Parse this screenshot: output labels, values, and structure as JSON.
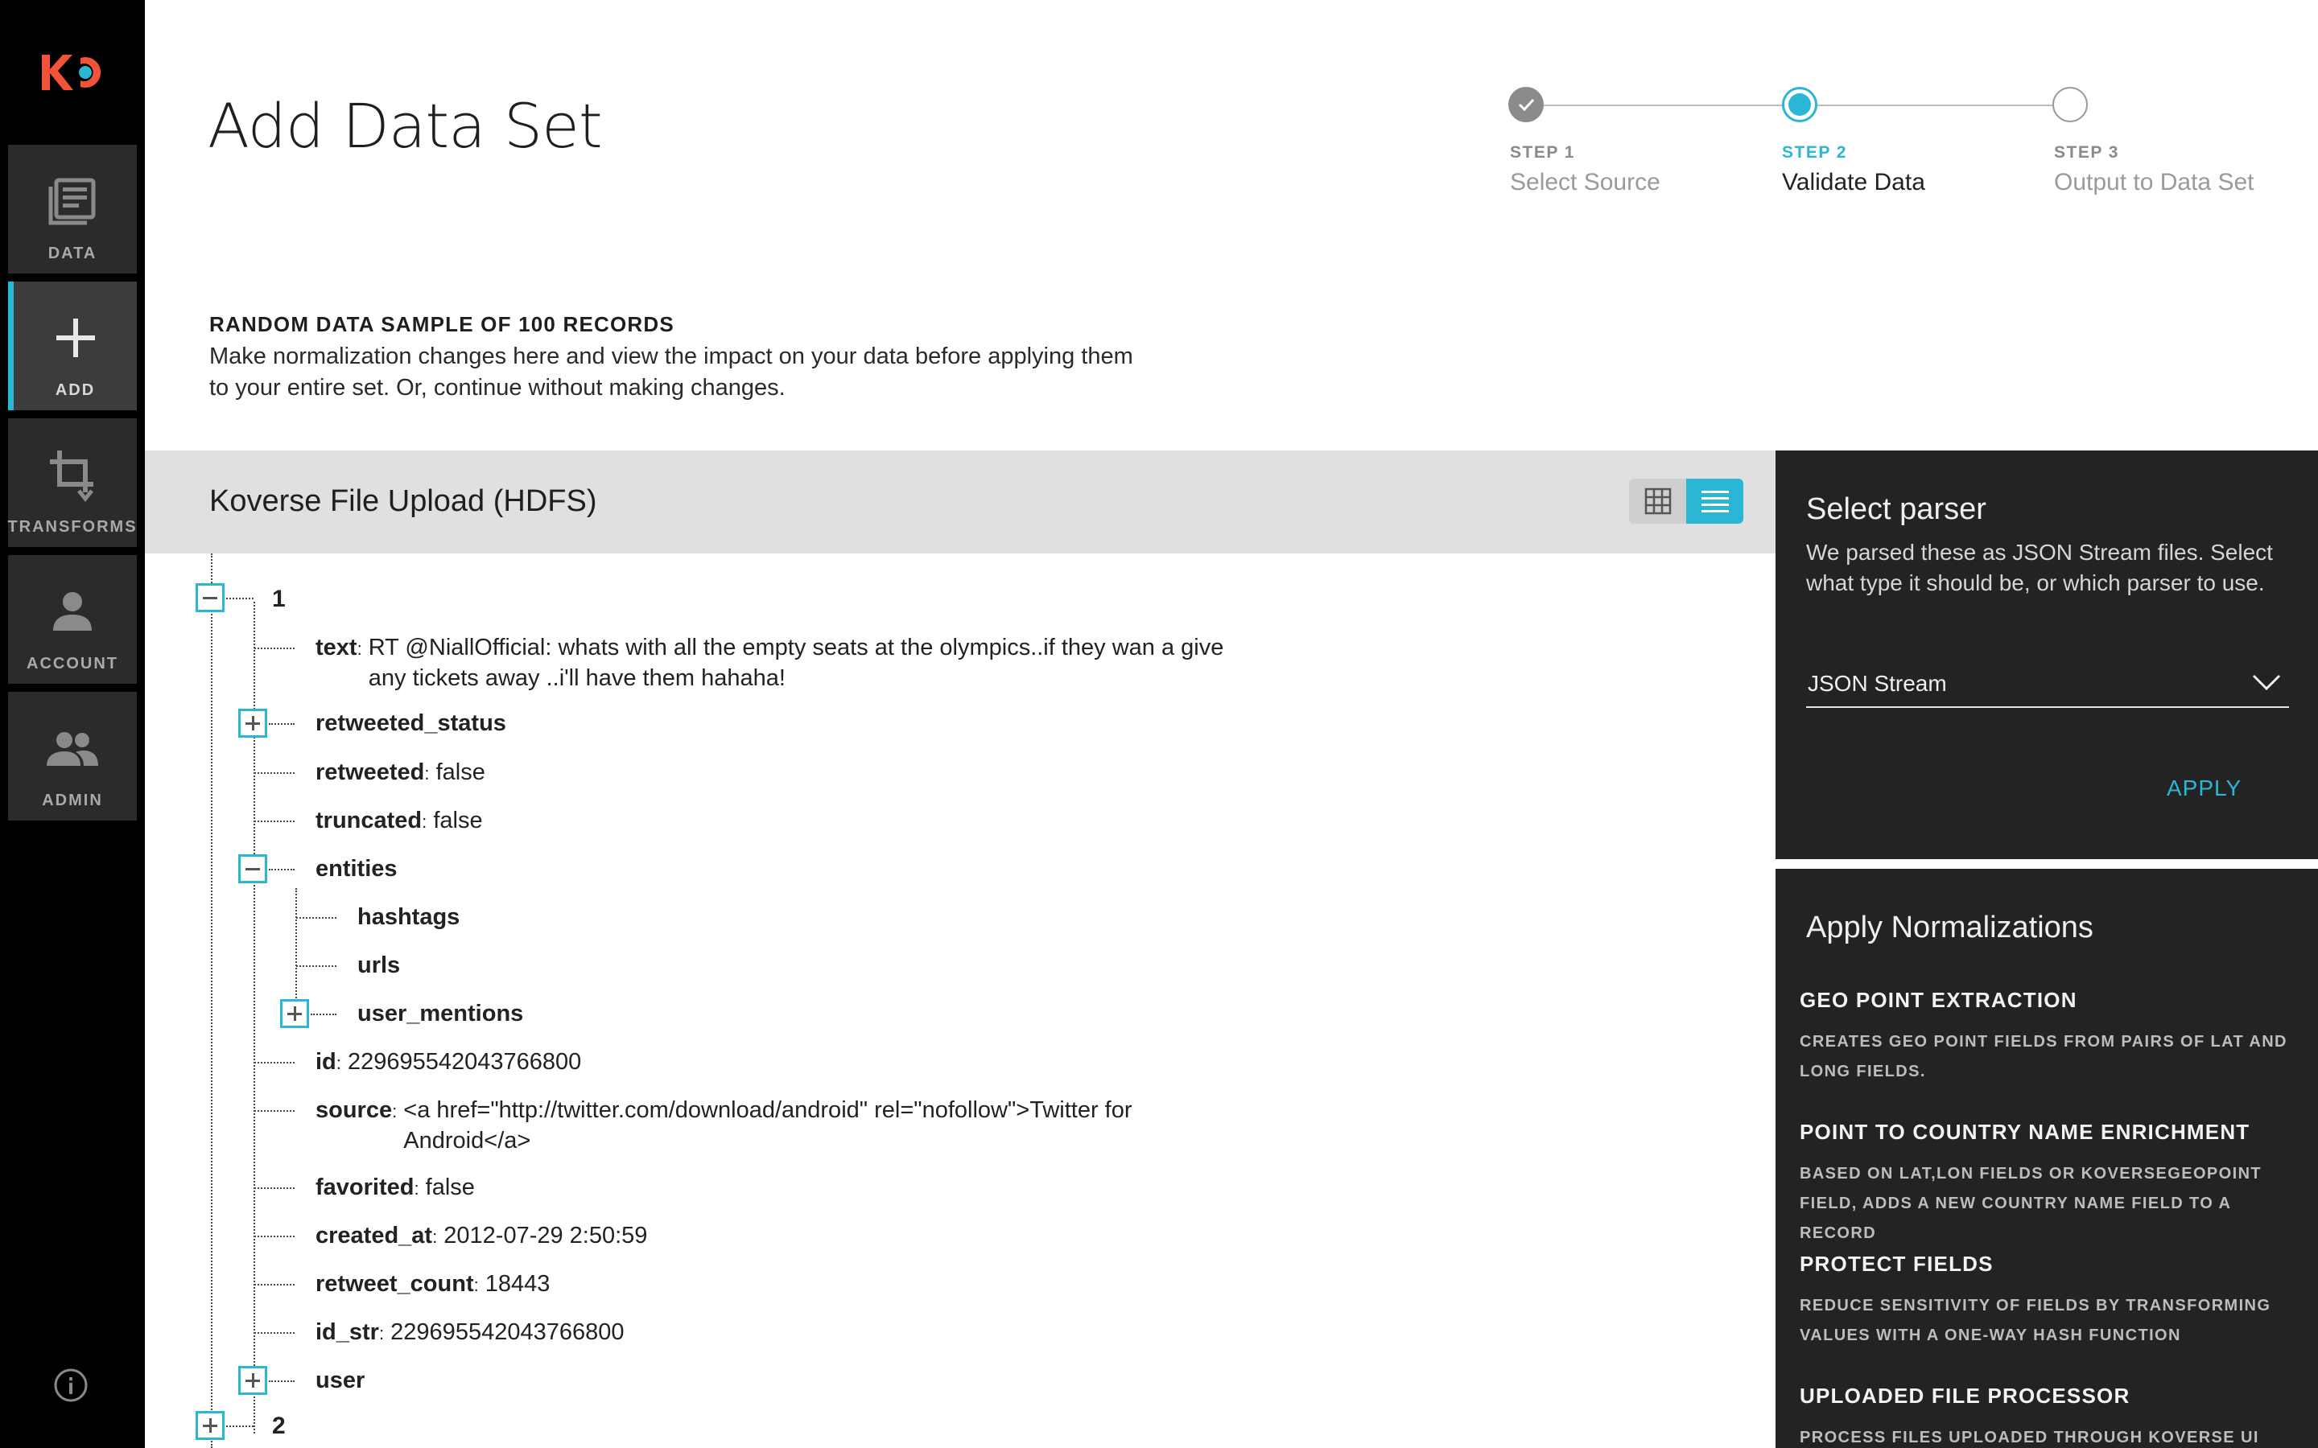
{
  "app": {
    "logo_text": "KO",
    "brand_color": "#f0533a",
    "accent_color": "#2ab6d4"
  },
  "nav": {
    "items": [
      {
        "label": "DATA",
        "icon": "data-icon"
      },
      {
        "label": "ADD",
        "icon": "plus-icon",
        "active": true
      },
      {
        "label": "TRANSFORMS",
        "icon": "crop-icon"
      },
      {
        "label": "ACCOUNT",
        "icon": "person-icon"
      },
      {
        "label": "ADMIN",
        "icon": "people-icon"
      }
    ],
    "info_icon": "info-icon"
  },
  "header": {
    "title": "Add Data Set"
  },
  "stepper": {
    "steps": [
      {
        "num": "STEP 1",
        "name": "Select Source",
        "state": "complete"
      },
      {
        "num": "STEP 2",
        "name": "Validate Data",
        "state": "current"
      },
      {
        "num": "STEP 3",
        "name": "Output to Data Set",
        "state": "pending"
      }
    ]
  },
  "sample": {
    "heading": "RANDOM DATA SAMPLE OF 100 RECORDS",
    "description": "Make normalization changes here and view the impact on your data before applying them to your entire set. Or, continue without making changes."
  },
  "panel": {
    "title": "Koverse File Upload (HDFS)",
    "view_modes": [
      "grid",
      "list"
    ],
    "active_view": "list"
  },
  "tree": {
    "records": [
      {
        "index": "1",
        "fields": [
          {
            "key": "text",
            "value": "RT @NiallOfficial: whats with all the empty seats at the olympics..if they wan a give any tickets away ..i'll have them hahaha!"
          },
          {
            "key": "retweeted_status",
            "collapsed": true
          },
          {
            "key": "retweeted",
            "value": "false"
          },
          {
            "key": "truncated",
            "value": "false"
          },
          {
            "key": "entities",
            "children": [
              "hashtags",
              "urls",
              "user_mentions"
            ]
          },
          {
            "key": "id",
            "value": "229695542043766800"
          },
          {
            "key": "source",
            "value": "<a href=\"http://twitter.com/download/android\" rel=\"nofollow\">Twitter for Android</a>"
          },
          {
            "key": "favorited",
            "value": "false"
          },
          {
            "key": "created_at",
            "value": "2012-07-29 2:50:59"
          },
          {
            "key": "retweet_count",
            "value": "18443"
          },
          {
            "key": "id_str",
            "value": "229695542043766800"
          },
          {
            "key": "user",
            "collapsed": true
          }
        ]
      },
      {
        "index": "2"
      }
    ],
    "separator": ":"
  },
  "parser": {
    "title": "Select parser",
    "description": "We parsed these as JSON Stream files. Select what type it should be, or which parser to use.",
    "selected": "JSON Stream",
    "apply_label": "APPLY"
  },
  "normalizations": {
    "title": "Apply Normalizations",
    "items": [
      {
        "name": "GEO POINT EXTRACTION",
        "desc": "CREATES GEO POINT FIELDS FROM PAIRS OF LAT AND LONG FIELDS."
      },
      {
        "name": "POINT TO COUNTRY NAME ENRICHMENT",
        "desc": "BASED ON LAT,LON FIELDS OR KOVERSEGEOPOINT FIELD, ADDS A NEW COUNTRY NAME FIELD TO A RECORD"
      },
      {
        "name": "PROTECT FIELDS",
        "desc": "REDUCE SENSITIVITY OF FIELDS BY TRANSFORMING VALUES WITH A ONE-WAY HASH FUNCTION"
      },
      {
        "name": "UPLOADED FILE PROCESSOR",
        "desc": "PROCESS FILES UPLOADED THROUGH KOVERSE UI"
      }
    ]
  }
}
